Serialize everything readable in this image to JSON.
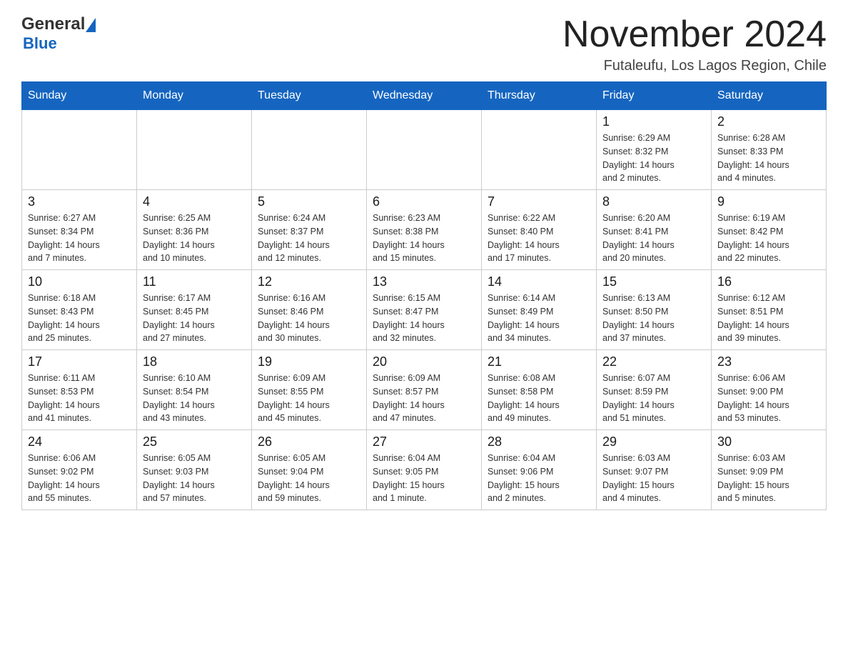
{
  "logo": {
    "text_general": "General",
    "triangle": "▲",
    "text_blue": "Blue"
  },
  "header": {
    "month_title": "November 2024",
    "location": "Futaleufu, Los Lagos Region, Chile"
  },
  "weekdays": [
    "Sunday",
    "Monday",
    "Tuesday",
    "Wednesday",
    "Thursday",
    "Friday",
    "Saturday"
  ],
  "weeks": [
    [
      {
        "day": "",
        "info": ""
      },
      {
        "day": "",
        "info": ""
      },
      {
        "day": "",
        "info": ""
      },
      {
        "day": "",
        "info": ""
      },
      {
        "day": "",
        "info": ""
      },
      {
        "day": "1",
        "info": "Sunrise: 6:29 AM\nSunset: 8:32 PM\nDaylight: 14 hours\nand 2 minutes."
      },
      {
        "day": "2",
        "info": "Sunrise: 6:28 AM\nSunset: 8:33 PM\nDaylight: 14 hours\nand 4 minutes."
      }
    ],
    [
      {
        "day": "3",
        "info": "Sunrise: 6:27 AM\nSunset: 8:34 PM\nDaylight: 14 hours\nand 7 minutes."
      },
      {
        "day": "4",
        "info": "Sunrise: 6:25 AM\nSunset: 8:36 PM\nDaylight: 14 hours\nand 10 minutes."
      },
      {
        "day": "5",
        "info": "Sunrise: 6:24 AM\nSunset: 8:37 PM\nDaylight: 14 hours\nand 12 minutes."
      },
      {
        "day": "6",
        "info": "Sunrise: 6:23 AM\nSunset: 8:38 PM\nDaylight: 14 hours\nand 15 minutes."
      },
      {
        "day": "7",
        "info": "Sunrise: 6:22 AM\nSunset: 8:40 PM\nDaylight: 14 hours\nand 17 minutes."
      },
      {
        "day": "8",
        "info": "Sunrise: 6:20 AM\nSunset: 8:41 PM\nDaylight: 14 hours\nand 20 minutes."
      },
      {
        "day": "9",
        "info": "Sunrise: 6:19 AM\nSunset: 8:42 PM\nDaylight: 14 hours\nand 22 minutes."
      }
    ],
    [
      {
        "day": "10",
        "info": "Sunrise: 6:18 AM\nSunset: 8:43 PM\nDaylight: 14 hours\nand 25 minutes."
      },
      {
        "day": "11",
        "info": "Sunrise: 6:17 AM\nSunset: 8:45 PM\nDaylight: 14 hours\nand 27 minutes."
      },
      {
        "day": "12",
        "info": "Sunrise: 6:16 AM\nSunset: 8:46 PM\nDaylight: 14 hours\nand 30 minutes."
      },
      {
        "day": "13",
        "info": "Sunrise: 6:15 AM\nSunset: 8:47 PM\nDaylight: 14 hours\nand 32 minutes."
      },
      {
        "day": "14",
        "info": "Sunrise: 6:14 AM\nSunset: 8:49 PM\nDaylight: 14 hours\nand 34 minutes."
      },
      {
        "day": "15",
        "info": "Sunrise: 6:13 AM\nSunset: 8:50 PM\nDaylight: 14 hours\nand 37 minutes."
      },
      {
        "day": "16",
        "info": "Sunrise: 6:12 AM\nSunset: 8:51 PM\nDaylight: 14 hours\nand 39 minutes."
      }
    ],
    [
      {
        "day": "17",
        "info": "Sunrise: 6:11 AM\nSunset: 8:53 PM\nDaylight: 14 hours\nand 41 minutes."
      },
      {
        "day": "18",
        "info": "Sunrise: 6:10 AM\nSunset: 8:54 PM\nDaylight: 14 hours\nand 43 minutes."
      },
      {
        "day": "19",
        "info": "Sunrise: 6:09 AM\nSunset: 8:55 PM\nDaylight: 14 hours\nand 45 minutes."
      },
      {
        "day": "20",
        "info": "Sunrise: 6:09 AM\nSunset: 8:57 PM\nDaylight: 14 hours\nand 47 minutes."
      },
      {
        "day": "21",
        "info": "Sunrise: 6:08 AM\nSunset: 8:58 PM\nDaylight: 14 hours\nand 49 minutes."
      },
      {
        "day": "22",
        "info": "Sunrise: 6:07 AM\nSunset: 8:59 PM\nDaylight: 14 hours\nand 51 minutes."
      },
      {
        "day": "23",
        "info": "Sunrise: 6:06 AM\nSunset: 9:00 PM\nDaylight: 14 hours\nand 53 minutes."
      }
    ],
    [
      {
        "day": "24",
        "info": "Sunrise: 6:06 AM\nSunset: 9:02 PM\nDaylight: 14 hours\nand 55 minutes."
      },
      {
        "day": "25",
        "info": "Sunrise: 6:05 AM\nSunset: 9:03 PM\nDaylight: 14 hours\nand 57 minutes."
      },
      {
        "day": "26",
        "info": "Sunrise: 6:05 AM\nSunset: 9:04 PM\nDaylight: 14 hours\nand 59 minutes."
      },
      {
        "day": "27",
        "info": "Sunrise: 6:04 AM\nSunset: 9:05 PM\nDaylight: 15 hours\nand 1 minute."
      },
      {
        "day": "28",
        "info": "Sunrise: 6:04 AM\nSunset: 9:06 PM\nDaylight: 15 hours\nand 2 minutes."
      },
      {
        "day": "29",
        "info": "Sunrise: 6:03 AM\nSunset: 9:07 PM\nDaylight: 15 hours\nand 4 minutes."
      },
      {
        "day": "30",
        "info": "Sunrise: 6:03 AM\nSunset: 9:09 PM\nDaylight: 15 hours\nand 5 minutes."
      }
    ]
  ]
}
